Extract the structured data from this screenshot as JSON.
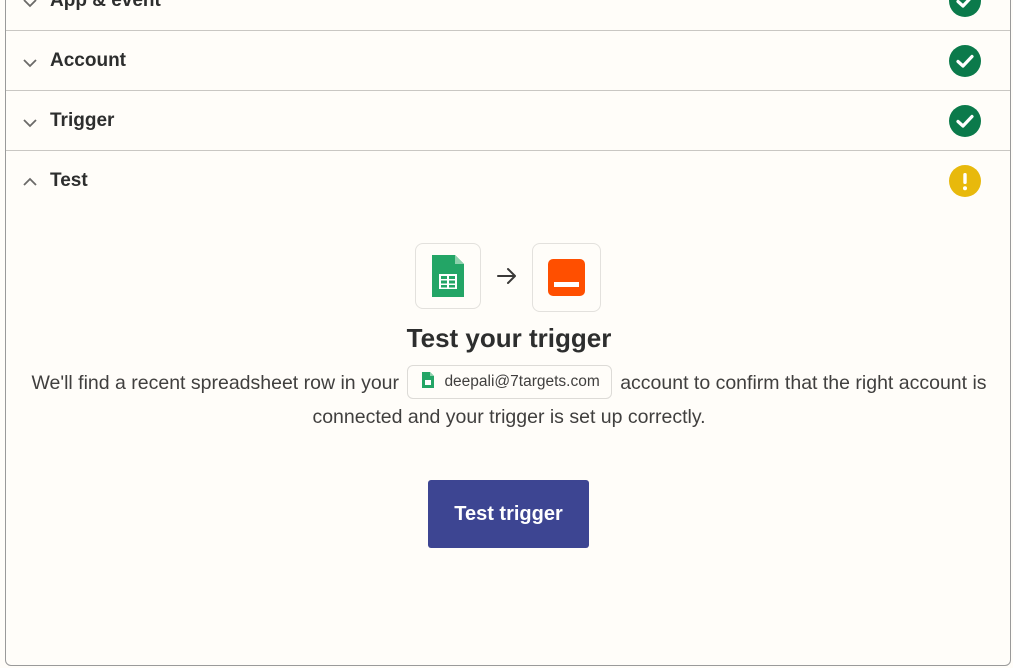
{
  "sections": [
    {
      "title": "App & event",
      "status": "complete"
    },
    {
      "title": "Account",
      "status": "complete"
    },
    {
      "title": "Trigger",
      "status": "complete"
    },
    {
      "title": "Test",
      "status": "warning"
    }
  ],
  "test": {
    "source_app_icon": "google-sheets-icon",
    "destination_app_icon": "webhook-app-icon",
    "title": "Test your trigger",
    "desc_before": "We'll find a recent spreadsheet row in your",
    "account_email": "deepali@7targets.com",
    "desc_after": "account to confirm that the right account is connected and your trigger is set up correctly.",
    "button_label": "Test trigger"
  },
  "colors": {
    "complete": "#0b7a4b",
    "warning": "#e8b90c",
    "button": "#3d4592",
    "destination_app": "#ff4f00",
    "sheets_green": "#23a566"
  }
}
